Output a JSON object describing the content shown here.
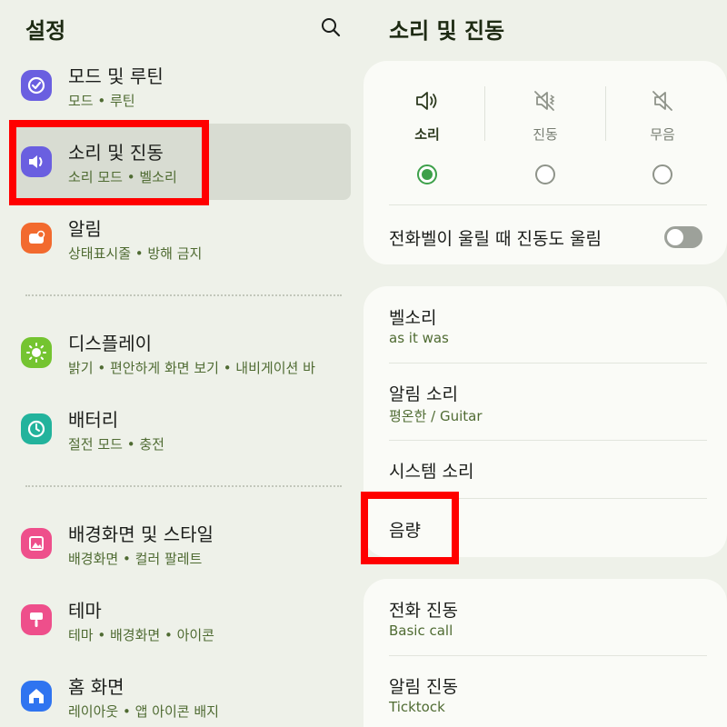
{
  "left_pane": {
    "title": "설정",
    "items": [
      {
        "title": "모드 및 루틴",
        "subtitle": "모드 • 루틴",
        "icon": "modes-routines-icon",
        "color": "#6a5fe0"
      },
      {
        "title": "소리 및 진동",
        "subtitle": "소리 모드 • 벨소리",
        "icon": "speaker-icon",
        "color": "#6a5fe0",
        "selected": true
      },
      {
        "title": "알림",
        "subtitle": "상태표시줄 • 방해 금지",
        "icon": "notification-icon",
        "color": "#f26a2e"
      },
      {
        "title": "디스플레이",
        "subtitle": "밝기 • 편안하게 화면 보기 • 내비게이션 바",
        "icon": "brightness-icon",
        "color": "#74c430"
      },
      {
        "title": "배터리",
        "subtitle": "절전 모드 • 충전",
        "icon": "battery-icon",
        "color": "#22b39c"
      },
      {
        "title": "배경화면 및 스타일",
        "subtitle": "배경화면 • 컬러 팔레트",
        "icon": "wallpaper-icon",
        "color": "#ee4f8b"
      },
      {
        "title": "테마",
        "subtitle": "테마 • 배경화면 • 아이콘",
        "icon": "theme-brush-icon",
        "color": "#ee4f8b"
      },
      {
        "title": "홈 화면",
        "subtitle": "레이아웃 • 앱 아이콘 배지",
        "icon": "home-icon",
        "color": "#2f74f0"
      }
    ]
  },
  "right_pane": {
    "title": "소리 및 진동",
    "modes": [
      {
        "label": "소리",
        "icon": "sound-icon",
        "selected": true
      },
      {
        "label": "진동",
        "icon": "vibrate-icon",
        "selected": false
      },
      {
        "label": "무음",
        "icon": "mute-icon",
        "selected": false
      }
    ],
    "vibrate_on_ring_label": "전화벨이 울릴 때 진동도 울림",
    "vibrate_on_ring_enabled": false,
    "sound_rows": [
      {
        "title": "벨소리",
        "subtitle": "as it was"
      },
      {
        "title": "알림 소리",
        "subtitle": "평온한 / Guitar"
      },
      {
        "title": "시스템 소리",
        "subtitle": ""
      },
      {
        "title": "음량",
        "subtitle": ""
      }
    ],
    "vibration_rows": [
      {
        "title": "전화 진동",
        "subtitle": "Basic call"
      },
      {
        "title": "알림 진동",
        "subtitle": "Ticktock"
      }
    ]
  },
  "colors": {
    "accent_green": "#3da04a",
    "highlight_red": "#ff0000",
    "background": "#eef1e9"
  }
}
